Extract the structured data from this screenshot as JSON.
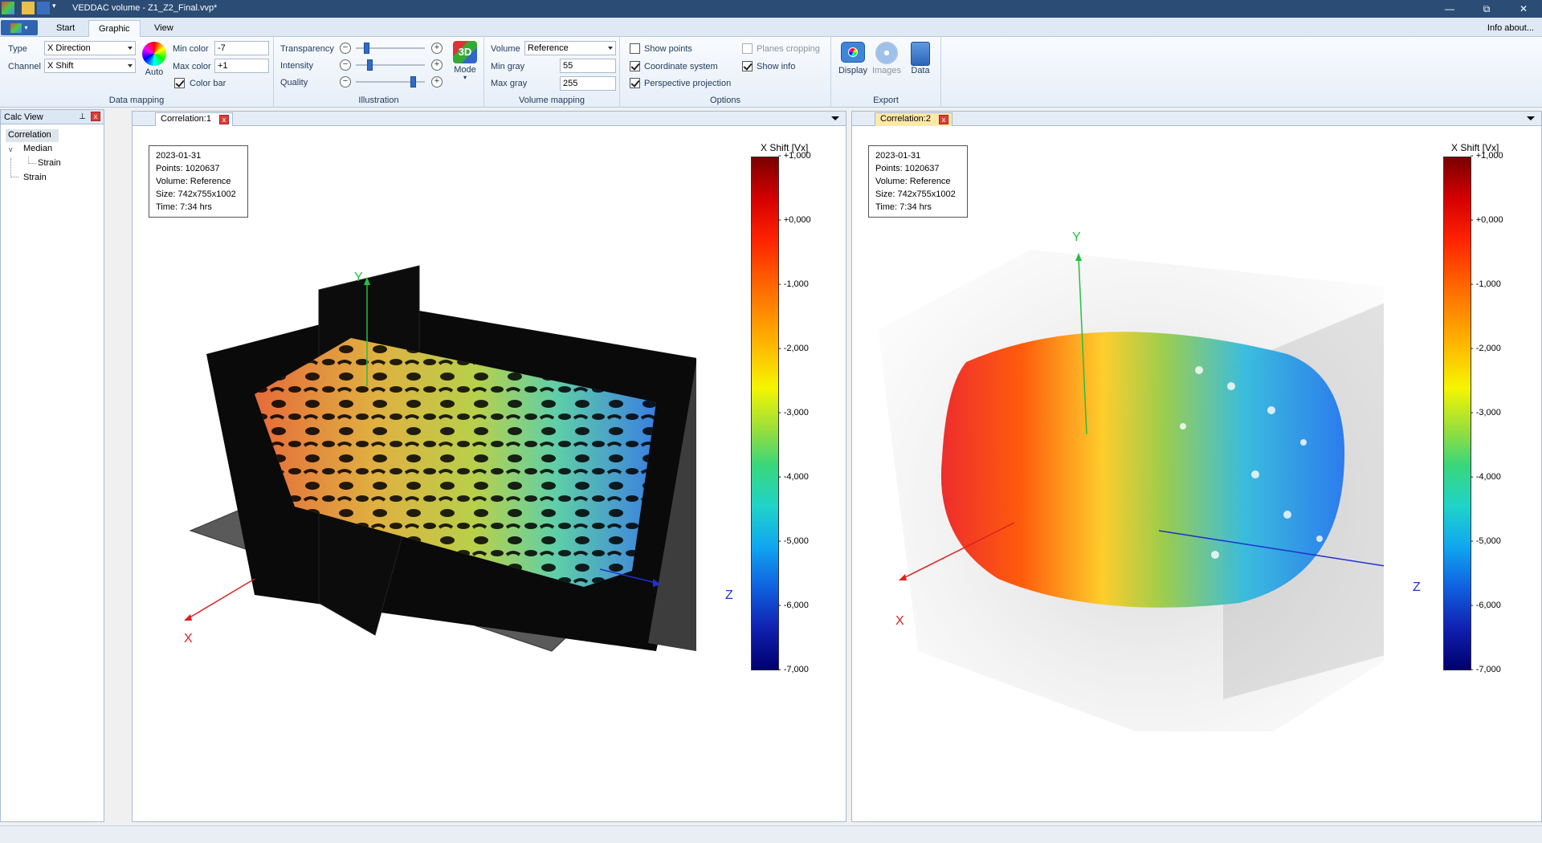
{
  "window": {
    "title": "VEDDAC volume - Z1_Z2_Final.vvp*",
    "minimize": "—",
    "restore": "⧉",
    "close": "✕"
  },
  "tabs": [
    {
      "label": "Start"
    },
    {
      "label": "Graphic"
    },
    {
      "label": "View"
    }
  ],
  "info_about": "Info about...",
  "data_mapping": {
    "group_label": "Data mapping",
    "type_label": "Type",
    "type_value": "X Direction",
    "channel_label": "Channel",
    "channel_value": "X Shift",
    "auto_label": "Auto",
    "min_color_label": "Min color",
    "min_color_value": "-7",
    "max_color_label": "Max color",
    "max_color_value": "+1",
    "color_bar_label": "Color bar",
    "color_bar_checked": true
  },
  "illustration": {
    "group_label": "Illustration",
    "transparency_label": "Transparency",
    "transparency_level": 0.12,
    "intensity_label": "Intensity",
    "intensity_level": 0.18,
    "quality_label": "Quality",
    "quality_level": 0.85,
    "mode_label": "Mode",
    "mode_icon_text": "3D"
  },
  "volume_mapping": {
    "group_label": "Volume mapping",
    "volume_label": "Volume",
    "volume_value": "Reference",
    "min_gray_label": "Min gray",
    "min_gray_value": "55",
    "max_gray_label": "Max gray",
    "max_gray_value": "255"
  },
  "options": {
    "group_label": "Options",
    "show_points": "Show points",
    "coordinate_system": "Coordinate system",
    "perspective_projection": "Perspective projection",
    "planes_cropping": "Planes cropping",
    "show_info": "Show info"
  },
  "export": {
    "group_label": "Export",
    "display": "Display",
    "images": "Images",
    "data": "Data"
  },
  "calc_view": {
    "title": "Calc View",
    "pin": "⊥",
    "close": "x",
    "tree": {
      "root": "Correlation",
      "median": "Median",
      "median_child": "Strain",
      "strain": "Strain",
      "expander": "v"
    }
  },
  "views": [
    {
      "tab": "Correlation:1",
      "close": "x",
      "info": {
        "date": "2023-01-31",
        "points": "Points: 1020637",
        "volume": "Volume: Reference",
        "size": "Size: 742x755x1002",
        "time": "Time: 7:34 hrs"
      },
      "colorbar_title": "X Shift [Vx]",
      "axes": {
        "x": "X",
        "y": "Y",
        "z": "Z"
      }
    },
    {
      "tab": "Correlation:2",
      "close": "x",
      "info": {
        "date": "2023-01-31",
        "points": "Points: 1020637",
        "volume": "Volume: Reference",
        "size": "Size: 742x755x1002",
        "time": "Time: 7:34 hrs"
      },
      "colorbar_title": "X Shift [Vx]",
      "axes": {
        "x": "X",
        "y": "Y",
        "z": "Z"
      }
    }
  ],
  "colorbar_ticks": [
    "+1,000",
    "+0,000",
    "-1,000",
    "-2,000",
    "-3,000",
    "-4,000",
    "-5,000",
    "-6,000",
    "-7,000"
  ]
}
